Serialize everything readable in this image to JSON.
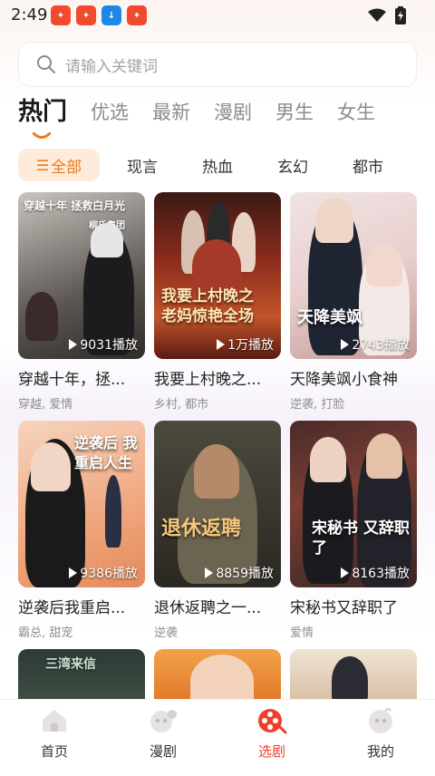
{
  "status": {
    "time": "2:49"
  },
  "search": {
    "placeholder": "请输入关键词"
  },
  "tabs": [
    {
      "label": "热门",
      "active": true
    },
    {
      "label": "优选"
    },
    {
      "label": "最新"
    },
    {
      "label": "漫剧"
    },
    {
      "label": "男生"
    },
    {
      "label": "女生"
    }
  ],
  "chips": [
    {
      "label": "全部",
      "active": true
    },
    {
      "label": "现言"
    },
    {
      "label": "热血"
    },
    {
      "label": "玄幻"
    },
    {
      "label": "都市"
    }
  ],
  "cards": [
    {
      "name": "穿越十年，拯...",
      "tags": "穿越, 爱情",
      "plays": "9031播放",
      "cover_text": "穿越十年 拯救白月光",
      "cover_sub": "柳氏集团"
    },
    {
      "name": "我要上村晚之...",
      "tags": "乡村, 都市",
      "plays": "1万播放",
      "cover_text": "我要上村晚之 老妈惊艳全场"
    },
    {
      "name": "天降美飒小食神",
      "tags": "逆袭, 打脸",
      "plays": "2743播放",
      "cover_text": "天降美飒"
    },
    {
      "name": "逆袭后我重启...",
      "tags": "霸总, 甜宠",
      "plays": "9386播放",
      "cover_text": "逆袭后 我重启人生"
    },
    {
      "name": "退休返聘之一...",
      "tags": "逆袭",
      "plays": "8859播放",
      "cover_text": "退休返聘"
    },
    {
      "name": "宋秘书又辞职了",
      "tags": "爱情",
      "plays": "8163播放",
      "cover_text": "宋秘书 又辞职了"
    },
    {
      "cover_text": "三湾来信"
    },
    {
      "cover_text": ""
    },
    {
      "cover_text": ""
    }
  ],
  "nav": [
    {
      "label": "首页",
      "icon": "home-icon"
    },
    {
      "label": "漫剧",
      "icon": "comic-icon"
    },
    {
      "label": "选剧",
      "icon": "film-reel-icon",
      "active": true
    },
    {
      "label": "我的",
      "icon": "profile-icon"
    }
  ],
  "colors": {
    "accent": "#ef7a16",
    "nav_active": "#ef3f2b"
  }
}
